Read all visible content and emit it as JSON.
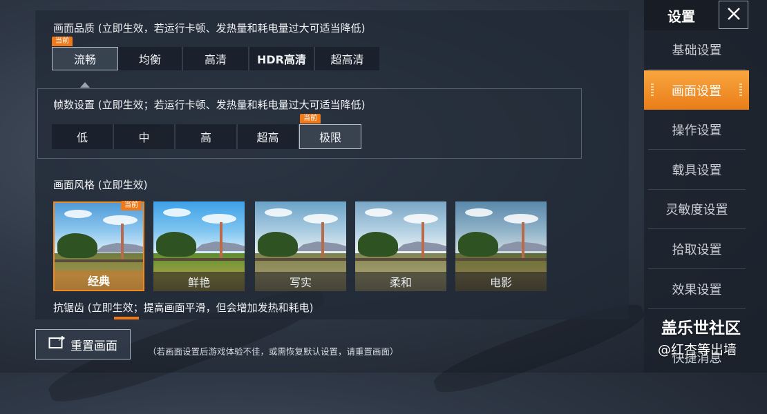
{
  "quality": {
    "title": "画面品质 (立即生效，若运行卡顿、发热量和耗电量过大可适当降低)",
    "current_tag": "当前",
    "options": [
      "流畅",
      "均衡",
      "高清",
      "HDR高清",
      "超高清"
    ],
    "selected": "流畅"
  },
  "fps": {
    "title": "帧数设置 (立即生效；若运行卡顿、发热量和耗电量过大可适当降低)",
    "current_tag": "当前",
    "options": [
      "低",
      "中",
      "高",
      "超高",
      "极限"
    ],
    "selected": "极限"
  },
  "style": {
    "title": "画面风格 (立即生效)",
    "current_tag": "当前",
    "options": [
      "经典",
      "鲜艳",
      "写实",
      "柔和",
      "电影"
    ],
    "selected": "经典"
  },
  "antialias": {
    "title": "抗锯齿 (立即生效；提高画面平滑，但会增加发热和耗电)"
  },
  "reset": {
    "label": "重置画面",
    "note": "（若画面设置后游戏体验不佳，或需恢复默认设置，请重置画面）"
  },
  "sidebar": {
    "title": "设置",
    "items": [
      "基础设置",
      "画面设置",
      "操作设置",
      "载具设置",
      "灵敏度设置",
      "拾取设置",
      "效果设置",
      "快捷消息"
    ],
    "active": "画面设置"
  },
  "watermark": {
    "line1": "盖乐世社区",
    "line2": "@红杏等出墙"
  },
  "colors": {
    "accent_orange": "#f08a20",
    "active_tab": "#f39a30"
  }
}
